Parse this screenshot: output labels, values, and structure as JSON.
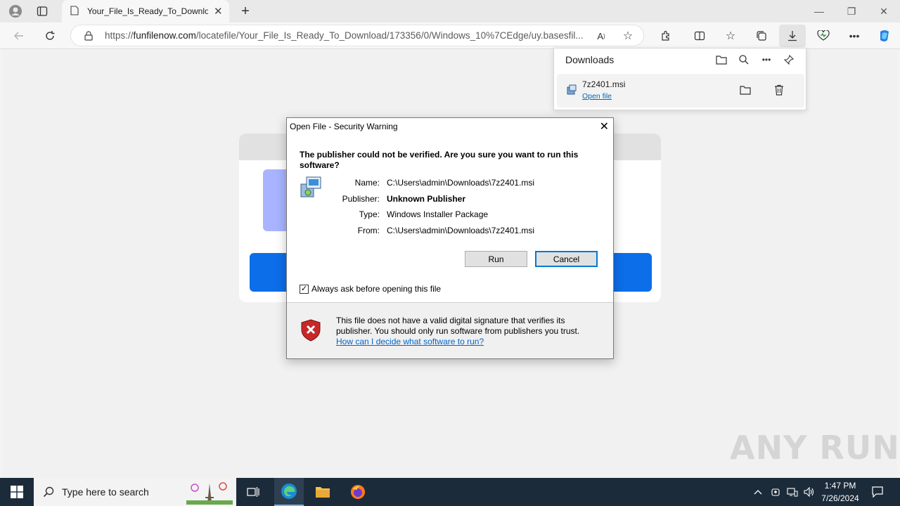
{
  "browser": {
    "tab_title": "Your_File_Is_Ready_To_Download",
    "url_prefix": "https://",
    "url_domain": "funfilenow.com",
    "url_path": "/locatefile/Your_File_Is_Ready_To_Download/173356/0/Windows_10%7CEdge/uy.basesfil..."
  },
  "downloads": {
    "title": "Downloads",
    "item_name": "7z2401.msi",
    "open_file_label": "Open file"
  },
  "dialog": {
    "title": "Open File - Security Warning",
    "question": "The publisher could not be verified.  Are you sure you want to run this software?",
    "properties": [
      {
        "label": "Name:",
        "value": "C:\\Users\\admin\\Downloads\\7z2401.msi"
      },
      {
        "label": "Publisher:",
        "value": "Unknown Publisher"
      },
      {
        "label": "Type:",
        "value": "Windows Installer Package"
      },
      {
        "label": "From:",
        "value": "C:\\Users\\admin\\Downloads\\7z2401.msi"
      }
    ],
    "run_label": "Run",
    "cancel_label": "Cancel",
    "checkbox_label": "Always ask before opening this file",
    "checkbox_checked": true,
    "warning_text": "This file does not have a valid digital signature that verifies its publisher.  You should only run software from publishers you trust.",
    "help_link": "How can I decide what software to run?"
  },
  "taskbar": {
    "search_placeholder": "Type here to search",
    "time": "1:47 PM",
    "date": "7/26/2024"
  },
  "watermark": "ANY RUN",
  "colors": {
    "accent": "#0078d7",
    "link": "#0066cc",
    "taskbar": "#1c2b3a",
    "page_button": "#0c6ee9"
  }
}
